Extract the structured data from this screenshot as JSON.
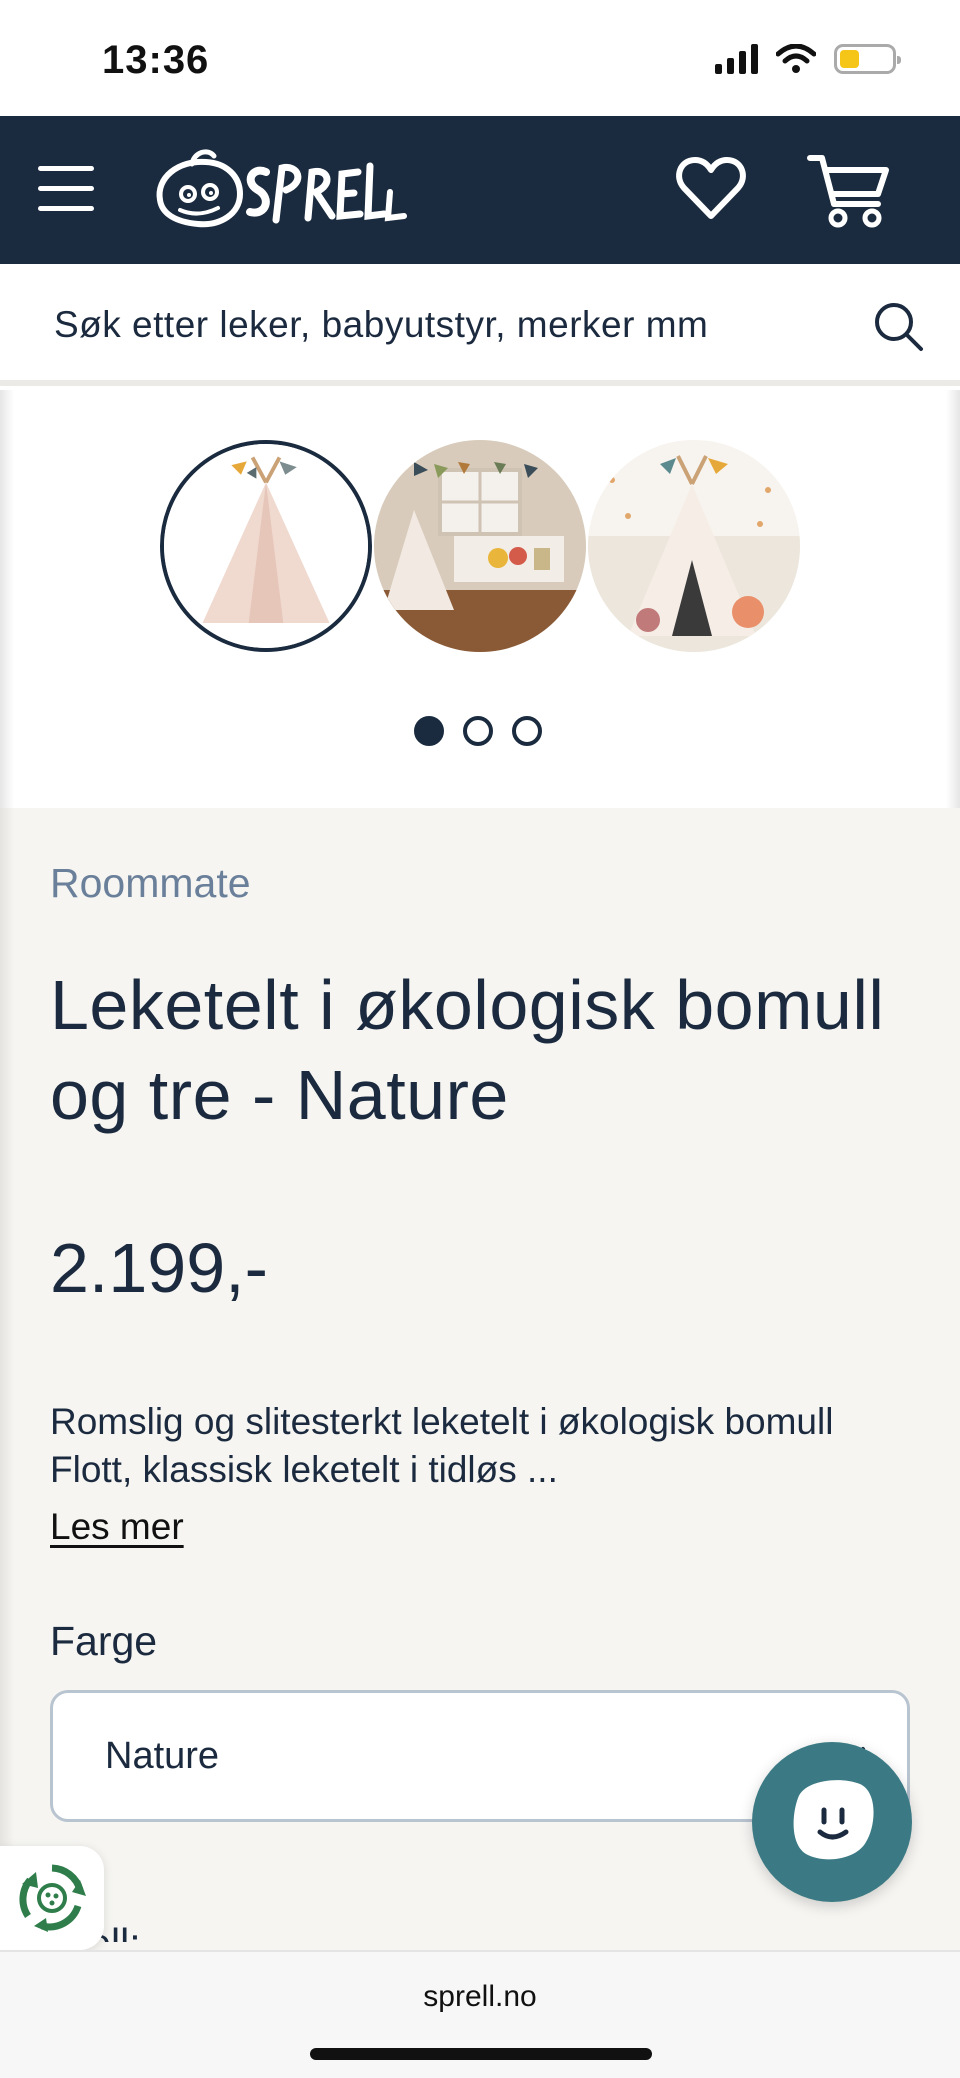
{
  "status_bar": {
    "time": "13:36",
    "icons": [
      "signal-icon",
      "wifi-icon",
      "battery-icon"
    ],
    "battery_level": 0.38,
    "battery_color": "#f5c518"
  },
  "header": {
    "logo_text": "SPRELL",
    "background_color": "#1b2b3f",
    "icons": [
      "menu-icon",
      "heart-icon",
      "cart-icon"
    ]
  },
  "search": {
    "placeholder": "Søk etter leker, babyutstyr, merker mm"
  },
  "gallery": {
    "image_count": 3,
    "active_index": 0,
    "images": [
      "teepee-tent-product",
      "teepee-tent-room",
      "teepee-tent-playroom"
    ]
  },
  "product": {
    "brand": "Roommate",
    "title": "Leketelt i økologisk bomull og tre - Nature",
    "price": "2.199,-",
    "description_line1": "Romslig og slitesterkt leketelt i økologisk bomull",
    "description_line2": "Flott, klassisk leketelt i tidløs ...",
    "read_more": "Les mer",
    "color_label": "Farge",
    "color_value": "Nature",
    "next_label_partial": "...ell:"
  },
  "browser": {
    "url": "sprell.no"
  },
  "colors": {
    "navy": "#1b2b3f",
    "product_bg": "#f6f5f2",
    "brand_text": "#6a7f99",
    "chat_button": "#3b7a84"
  }
}
